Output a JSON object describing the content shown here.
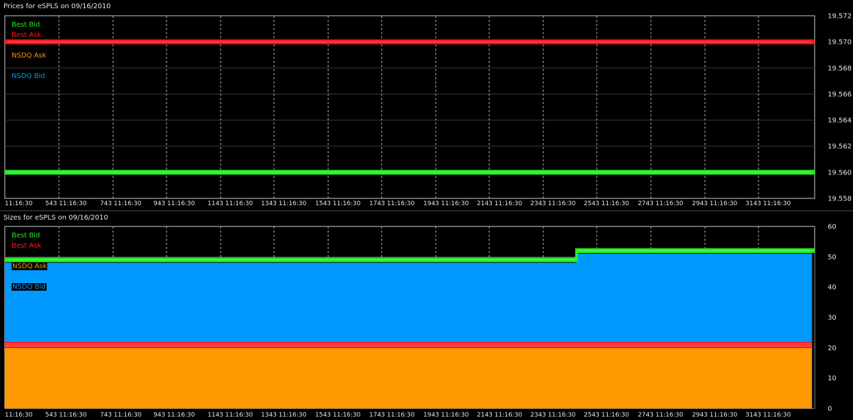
{
  "colors": {
    "best_bid": "#22ee22",
    "best_ask": "#ff1a1a",
    "nsdq_ask": "#ff9900",
    "nsdq_bid": "#0099ff",
    "grid": "#bbbbbb",
    "text": "#e6e6e6"
  },
  "chart_data": [
    {
      "type": "line",
      "title": "Prices for  eSPLS  on  09/16/2010",
      "x_tick_labels": [
        "11:16:30",
        "543 11:16:30",
        "743 11:16:30",
        "943 11:16:30",
        "1143 11:16:30",
        "1343 11:16:30",
        "1543 11:16:30",
        "1743 11:16:30",
        "1943 11:16:30",
        "2143 11:16:30",
        "2343 11:16:30",
        "2543 11:16:30",
        "2743 11:16:30",
        "2943 11:16:30",
        "3143 11:16:30"
      ],
      "y_tick_labels": [
        "19.572",
        "19.570",
        "19.568",
        "19.566",
        "19.564",
        "19.562",
        "19.560",
        "19.558"
      ],
      "ylim": [
        19.558,
        19.572
      ],
      "grid": true,
      "legend_position": "top-left",
      "series": [
        {
          "name": "Best Bid",
          "color": "#22ee22",
          "values": [
            19.56,
            19.56
          ]
        },
        {
          "name": "Best Ask",
          "color": "#ff1a1a",
          "values": [
            19.57,
            19.57
          ]
        },
        {
          "name": "NSDQ Ask",
          "color": "#ff9900",
          "values": []
        },
        {
          "name": "NSDQ Bid",
          "color": "#0099ff",
          "values": []
        }
      ]
    },
    {
      "type": "area",
      "title": "Sizes for  eSPLS  on  09/16/2010",
      "x_tick_labels": [
        "11:16:30",
        "543 11:16:30",
        "743 11:16:30",
        "943 11:16:30",
        "1143 11:16:30",
        "1343 11:16:30",
        "1543 11:16:30",
        "1743 11:16:30",
        "1943 11:16:30",
        "2143 11:16:30",
        "2343 11:16:30",
        "2543 11:16:30",
        "2743 11:16:30",
        "2943 11:16:30",
        "3143 11:16:30"
      ],
      "y_tick_labels": [
        "60",
        "50",
        "40",
        "30",
        "20",
        "10",
        "0"
      ],
      "ylim": [
        0,
        60
      ],
      "grid": true,
      "legend_position": "top-left",
      "series": [
        {
          "name": "Best Bid",
          "color": "#22ee22",
          "segments": [
            {
              "x_from": 0,
              "x_to": 0.706,
              "value": 49
            },
            {
              "x_from": 0.706,
              "x_to": 1,
              "value": 52
            }
          ]
        },
        {
          "name": "Best Ask",
          "color": "#ff1a1a",
          "segments": [
            {
              "x_from": 0,
              "x_to": 1,
              "value": 21
            }
          ]
        },
        {
          "name": "NSDQ Ask",
          "color": "#ff9900",
          "segments": [
            {
              "x_from": 0,
              "x_to": 1,
              "value": 20
            }
          ]
        },
        {
          "name": "NSDQ Bid",
          "color": "#0099ff",
          "segments": [
            {
              "x_from": 0,
              "x_to": 0.706,
              "value": 48
            },
            {
              "x_from": 0.706,
              "x_to": 1,
              "value": 51
            }
          ]
        }
      ]
    }
  ]
}
